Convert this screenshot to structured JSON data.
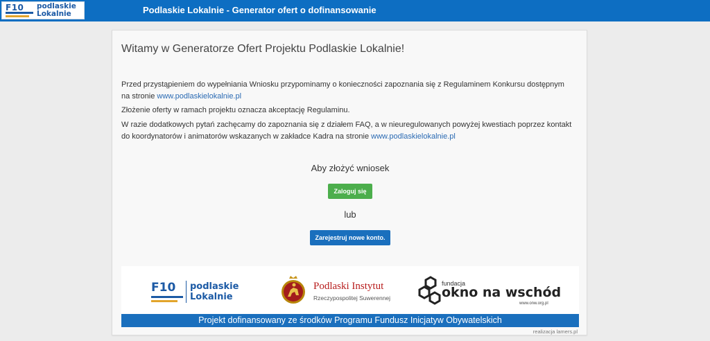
{
  "header": {
    "logo": {
      "mark": "F10",
      "name_line1": "podlaskie",
      "name_line2": "Lokalnie"
    },
    "title": "Podlaskie Lokalnie - Generator ofert o dofinansowanie"
  },
  "main": {
    "welcome_title": "Witamy w Generatorze Ofert Projektu Podlaskie Lokalnie!",
    "intro": {
      "text": "Przed przystąpieniem do wypełniania Wniosku przypominamy o konieczności zapoznania się z Regulaminem Konkursu dostępnym na stronie ",
      "link": "www.podlaskielokalnie.pl"
    },
    "acceptance": "Złożenie oferty w ramach projektu oznacza akceptację Regulaminu.",
    "contact": {
      "text": "W razie dodatkowych pytań zachęcamy do zapoznania się z działem FAQ, a w nieuregulowanych powyżej kwestiach poprzez kontakt do koordynatorów i animatorów wskazanych w zakładce Kadra na stronie ",
      "link": "www.podlaskielokalnie.pl"
    },
    "cta_title": "Aby złożyć wniosek",
    "login_label": "Zaloguj się",
    "or_label": "lub",
    "register_label": "Zarejestruj nowe konto."
  },
  "footer": {
    "f10_logo": {
      "mark": "F10",
      "name_line1": "podlaskie",
      "name_line2": "Lokalnie"
    },
    "institute_logo": {
      "name": "Podlaski Instytut",
      "subtitle": "Rzeczypospolitej Suwerennej"
    },
    "onw_logo": {
      "prefix": "fundacja",
      "name": "okno na wschód",
      "url": "www.onw.org.pl"
    },
    "funding_note": "Projekt dofinansowany ze środków Programu Fundusz Inicjatyw Obywatelskich",
    "credit": "realizacja lamers.pl"
  },
  "colors": {
    "header_bg": "#0d6ec2",
    "login_button": "#4cae4c",
    "register_button": "#1a6fbd",
    "footer_band": "#1a6fbd",
    "link": "#2a6ab3"
  }
}
